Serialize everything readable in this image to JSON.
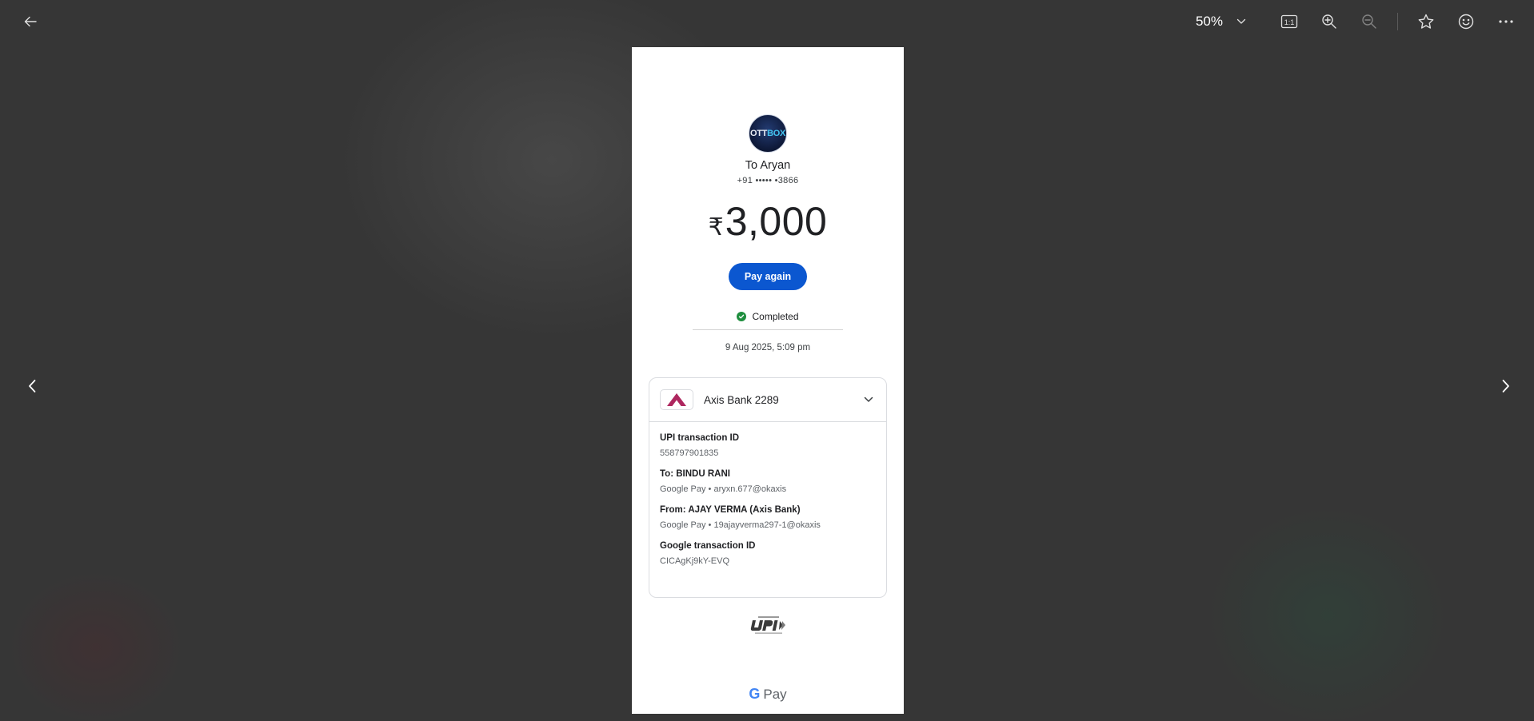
{
  "toolbar": {
    "zoom_level": "50%",
    "icons": [
      "back-arrow-icon",
      "chevron-down-icon",
      "actual-size-icon",
      "zoom-in-icon",
      "zoom-out-icon",
      "star-icon",
      "emoji-icon",
      "more-icon"
    ],
    "actual_size_label": "1:1"
  },
  "navigation": {
    "prev_icon": "chevron-left-icon",
    "next_icon": "chevron-right-icon"
  },
  "receipt": {
    "avatar_text": "OTT",
    "avatar_text_accent": "BOX",
    "to_name": "To Aryan",
    "to_phone": "+91 ••••• •3866",
    "currency_symbol": "₹",
    "amount": "3,000",
    "pay_again_label": "Pay again",
    "status": "Completed",
    "datetime": "9 Aug 2025, 5:09 pm",
    "bank": {
      "name": "Axis Bank 2289",
      "accent": "#ae275f"
    },
    "details": [
      {
        "label": "UPI transaction ID",
        "value": "558797901835"
      },
      {
        "label": "To: BINDU RANI",
        "value": "Google Pay • aryxn.677@okaxis"
      },
      {
        "label": "From: AJAY VERMA (Axis Bank)",
        "value": "Google Pay • 19ajayverma297-1@okaxis"
      },
      {
        "label": "Google transaction ID",
        "value": "CICAgKj9kY-EVQ"
      }
    ],
    "footer_brand_g": "G",
    "footer_brand": "Pay"
  },
  "colors": {
    "background": "#363636",
    "primary_button": "#0b57d0",
    "success": "#1e8e3e"
  }
}
